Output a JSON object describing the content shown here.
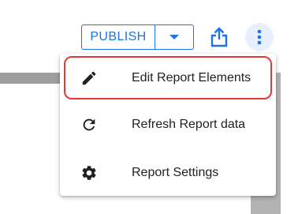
{
  "toolbar": {
    "publish_label": "PUBLISH",
    "publish_dropdown_icon": "caret-down-icon",
    "share_icon": "share-upload-icon",
    "more_icon": "more-vertical-icon"
  },
  "menu": {
    "items": [
      {
        "label": "Edit Report Elements",
        "icon": "pencil-icon",
        "highlighted": true
      },
      {
        "label": "Refresh Report data",
        "icon": "refresh-icon",
        "highlighted": false
      },
      {
        "label": "Report Settings",
        "icon": "gear-icon",
        "highlighted": false
      }
    ]
  },
  "colors": {
    "accent": "#1a73e8",
    "highlight": "#e53935",
    "more_button_bg": "#e8f0fe"
  }
}
